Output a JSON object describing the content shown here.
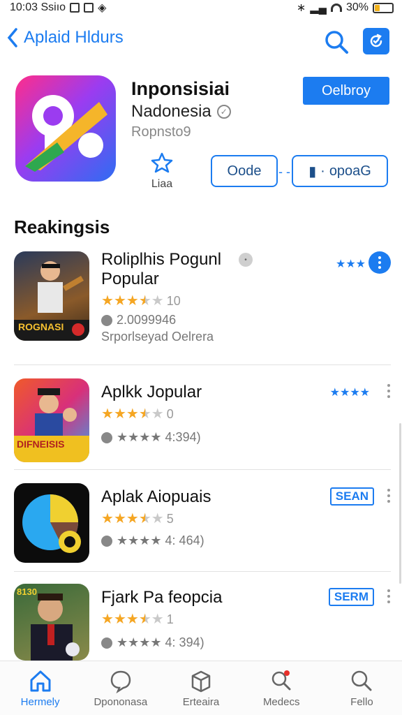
{
  "status_bar": {
    "time": "10:03 Ssiıo",
    "battery": "30%",
    "battery_level": 0.3
  },
  "nav": {
    "back_label": "Aplaid  Hldurs"
  },
  "app": {
    "title": "Inponsisiai",
    "subtitle": "Nadonesia",
    "developer": "Ropnsto9",
    "get_label": "Oelbroy",
    "rate_label": "Liaa",
    "button_a": "Oode",
    "button_b": "opoaG"
  },
  "section": {
    "title": "Reakingsis"
  },
  "list": [
    {
      "name": "Roliplhis Pogunl",
      "name2": "Popular",
      "rating_value": 3.5,
      "rating_text": "10",
      "meta1": "2.0099946",
      "meta2": "Srporlseyad Oelrera",
      "rank": "★★★",
      "thumb_text": "ROGNASI"
    },
    {
      "name": "Aplkk Jopular",
      "rating_value": 3.5,
      "rating_text": "0",
      "meta1": "★★★★ 4:394)",
      "rank": "★★★★",
      "thumb_text": "DIFNEISIS"
    },
    {
      "name": "Aplak Aiopuais",
      "rating_value": 3.5,
      "rating_text": "5",
      "meta1": "★★★★ 4: 464)",
      "tag": "SEAN"
    },
    {
      "name": "Fjark Pa feopcia",
      "rating_value": 3.5,
      "rating_text": "1",
      "meta1": "★★★★ 4: 394)",
      "tag": "SERM",
      "thumb_text": "8130"
    }
  ],
  "tabs": [
    {
      "label": "Hermely",
      "icon": "home-icon",
      "active": true
    },
    {
      "label": "Dpononasa",
      "icon": "chat-bubble-icon"
    },
    {
      "label": "Erteaira",
      "icon": "box-icon"
    },
    {
      "label": "Medecs",
      "icon": "search-badge-icon"
    },
    {
      "label": "Fello",
      "icon": "search-icon"
    }
  ],
  "colors": {
    "accent": "#1c7cf0",
    "star": "#f5a623",
    "battery": "#f2b21b"
  }
}
